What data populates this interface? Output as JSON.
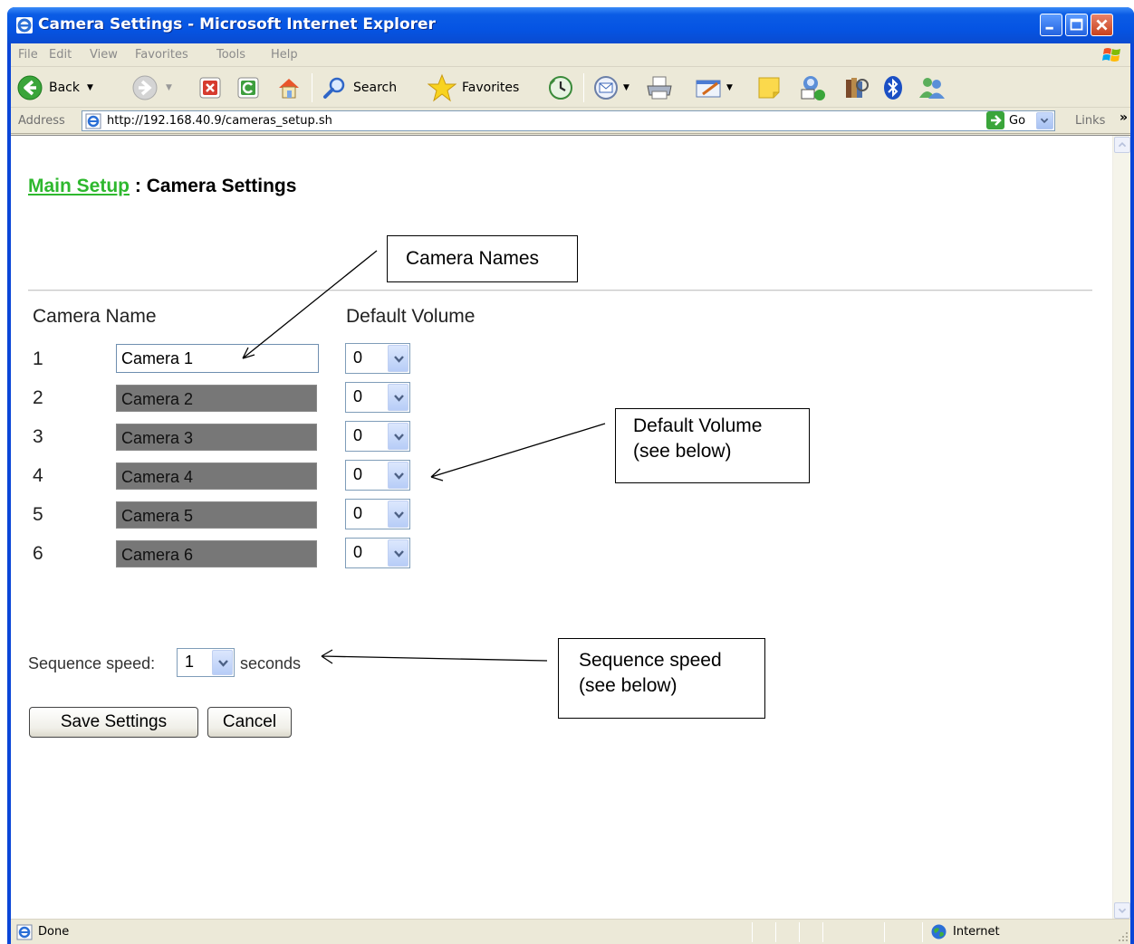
{
  "window": {
    "title": "Camera Settings - Microsoft Internet Explorer"
  },
  "menu": [
    "File",
    "Edit",
    "View",
    "Favorites",
    "Tools",
    "Help"
  ],
  "toolbar": {
    "back_label": "Back",
    "search_label": "Search",
    "favorites_label": "Favorites"
  },
  "address": {
    "label": "Address",
    "url": "http://192.168.40.9/cameras_setup.sh",
    "go_label": "Go",
    "links_label": "Links"
  },
  "page": {
    "breadcrumb_link": "Main Setup",
    "breadcrumb_sep": " : ",
    "title": "Camera Settings",
    "col_name": "Camera Name",
    "col_volume": "Default Volume",
    "cameras": [
      {
        "num": "1",
        "name": "Camera 1",
        "volume": "0",
        "enabled": true
      },
      {
        "num": "2",
        "name": "Camera 2",
        "volume": "0",
        "enabled": false
      },
      {
        "num": "3",
        "name": "Camera 3",
        "volume": "0",
        "enabled": false
      },
      {
        "num": "4",
        "name": "Camera 4",
        "volume": "0",
        "enabled": false
      },
      {
        "num": "5",
        "name": "Camera 5",
        "volume": "0",
        "enabled": false
      },
      {
        "num": "6",
        "name": "Camera 6",
        "volume": "0",
        "enabled": false
      }
    ],
    "sequence_label": "Sequence speed:",
    "sequence_value": "1",
    "sequence_unit": "seconds",
    "save_label": "Save Settings",
    "cancel_label": "Cancel"
  },
  "callouts": {
    "camera_names": "Camera Names",
    "default_volume_line1": "Default Volume",
    "default_volume_line2": "(see below)",
    "sequence_line1": "Sequence speed",
    "sequence_line2": "(see below)"
  },
  "status": {
    "text": "Done",
    "zone": "Internet"
  },
  "colors": {
    "titlebar": "#0554e3",
    "chrome": "#ece9d8",
    "link_green": "#2eb82e",
    "disabled_field": "#777777"
  }
}
